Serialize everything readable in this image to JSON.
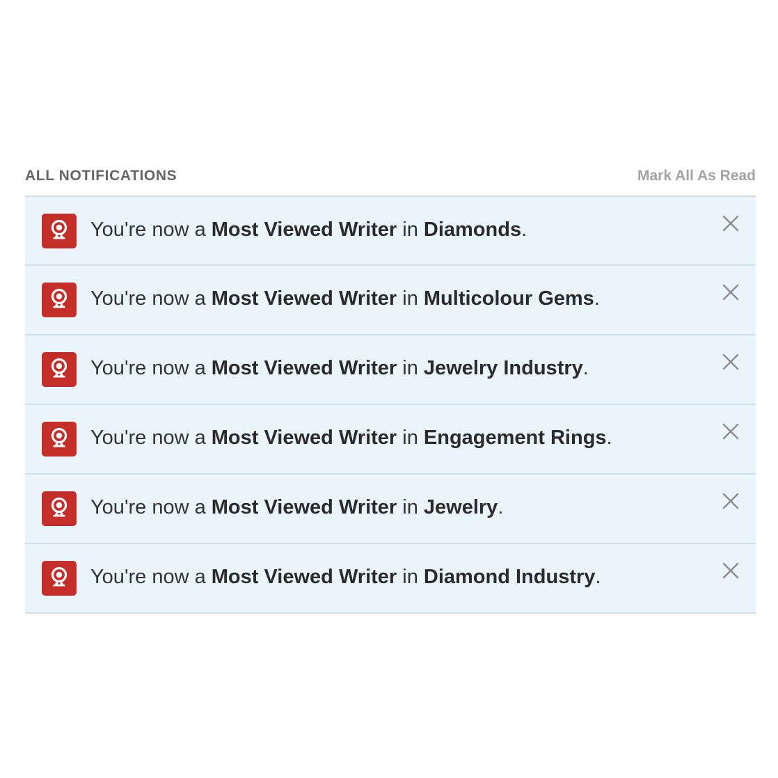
{
  "notifications_panel": {
    "title": "ALL NOTIFICATIONS",
    "mark_all_label": "Mark All As Read",
    "items": [
      {
        "prefix": "You're now a ",
        "role": "Most Viewed Writer",
        "middle": " in ",
        "topic": "Diamonds",
        "suffix": ".",
        "icon": "award-ribbon-icon"
      },
      {
        "prefix": "You're now a ",
        "role": "Most Viewed Writer",
        "middle": " in ",
        "topic": "Multicolour Gems",
        "suffix": ".",
        "icon": "award-ribbon-icon"
      },
      {
        "prefix": "You're now a ",
        "role": "Most Viewed Writer",
        "middle": " in ",
        "topic": "Jewelry Industry",
        "suffix": ".",
        "icon": "award-ribbon-icon"
      },
      {
        "prefix": "You're now a ",
        "role": "Most Viewed Writer",
        "middle": " in ",
        "topic": "Engagement Rings",
        "suffix": ".",
        "icon": "award-ribbon-icon"
      },
      {
        "prefix": "You're now a ",
        "role": "Most Viewed Writer",
        "middle": " in ",
        "topic": "Jewelry",
        "suffix": ".",
        "icon": "award-ribbon-icon"
      },
      {
        "prefix": "You're now a ",
        "role": "Most Viewed Writer",
        "middle": " in ",
        "topic": "Diamond Industry",
        "suffix": ".",
        "icon": "award-ribbon-icon"
      }
    ]
  },
  "colors": {
    "badge": "#c42e28",
    "row_background": "#eaf4fd",
    "row_border": "#cfdfed",
    "title": "#666666",
    "action": "#a3a3a3"
  }
}
